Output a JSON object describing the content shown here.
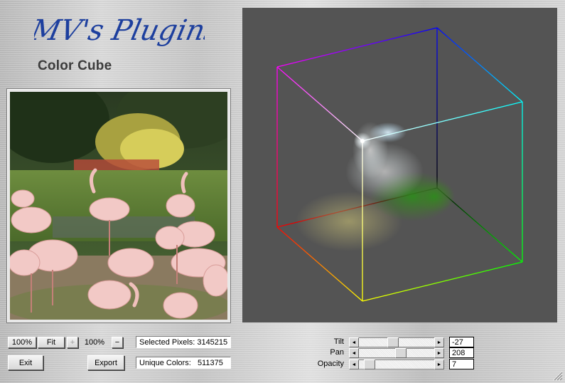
{
  "header": {
    "logo_text": "MV's Plugins",
    "subtitle": "Color Cube"
  },
  "colors": {
    "logo_blue": "#1d3f9e",
    "viewport_bg": "#545454"
  },
  "zoom_controls": {
    "zoom_100_label": "100%",
    "fit_label": "Fit",
    "plus_icon": "+",
    "zoom_value": "100%",
    "minus_icon": "−"
  },
  "buttons": {
    "exit_label": "Exit",
    "export_label": "Export"
  },
  "stats": {
    "selected_pixels_label": "Selected Pixels:",
    "selected_pixels_value": "3145215",
    "unique_colors_label": "Unique Colors:",
    "unique_colors_value": "511375"
  },
  "sliders": [
    {
      "label": "Tilt",
      "value": "-27",
      "level": 0.46
    },
    {
      "label": "Pan",
      "value": "208",
      "level": 0.58
    },
    {
      "label": "Opacity",
      "value": "7",
      "level": 0.08
    }
  ],
  "icons": {
    "scroll_left": "◄",
    "scroll_right": "►"
  }
}
